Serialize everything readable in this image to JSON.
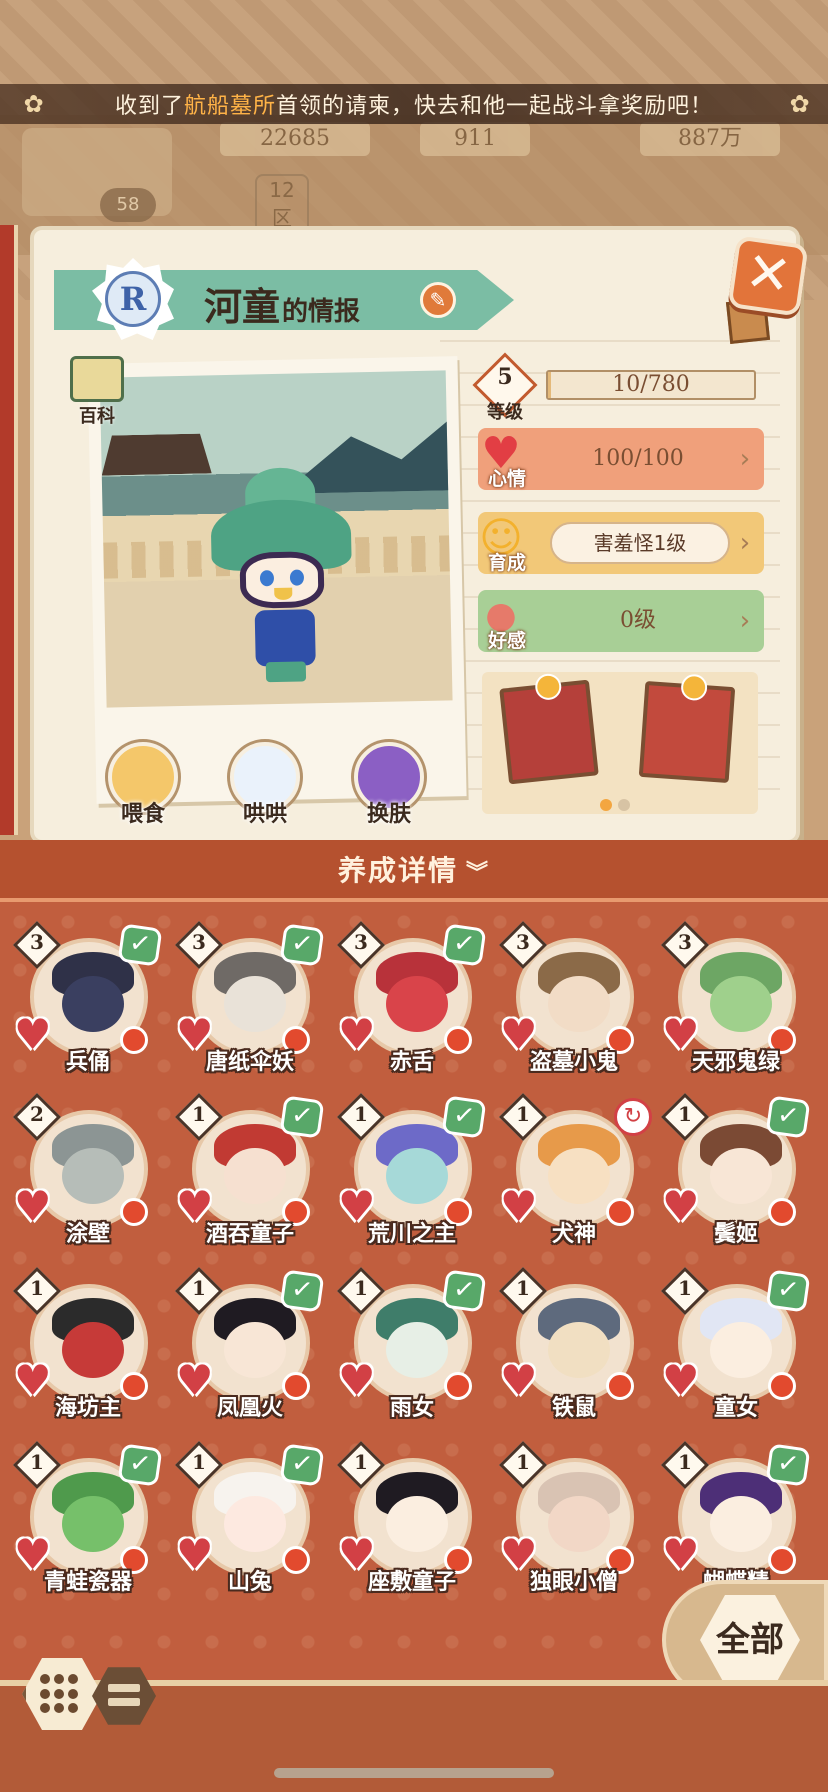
{
  "notice": {
    "prefix": "收到了",
    "highlight": "航船墓所",
    "suffix": "首领的请柬，快去和他一起战斗拿奖励吧！"
  },
  "background": {
    "resource_1": "22685",
    "resource_2": "911",
    "resource_3": "887万",
    "avatar_level": "58",
    "zone_number": "12",
    "zone_suffix": "区"
  },
  "profile": {
    "rarity": "R",
    "name": "河童",
    "title_suffix": "的情报",
    "pedia_label": "百科"
  },
  "actions": [
    {
      "label": "喂食",
      "color": "#f4c76a"
    },
    {
      "label": "哄哄",
      "color": "#eaf2fb"
    },
    {
      "label": "换肤",
      "color": "#8b5fc4"
    }
  ],
  "stats": {
    "level": {
      "value": "5",
      "label": "等级",
      "exp_text": "10/780",
      "exp_fraction": 0.013
    },
    "mood": {
      "label": "心情",
      "value": "100/100"
    },
    "nurture": {
      "label": "育成",
      "value": "害羞怪1级"
    },
    "affinity": {
      "label": "好感",
      "value": "0级"
    }
  },
  "gifts": {
    "page_count": 2,
    "active_page": 1
  },
  "detail": {
    "label": "养成详情",
    "chevron": "︾"
  },
  "shikigami": [
    {
      "name": "兵俑",
      "level": "3",
      "checked": true,
      "hair": "#2f3148",
      "face": "#3a3f60"
    },
    {
      "name": "唐纸伞妖",
      "level": "3",
      "checked": true,
      "hair": "#6f6a66",
      "face": "#e9e2d8"
    },
    {
      "name": "赤舌",
      "level": "3",
      "checked": true,
      "hair": "#b8323a",
      "face": "#d9444a"
    },
    {
      "name": "盗墓小鬼",
      "level": "3",
      "checked": false,
      "hair": "#8b6a48",
      "face": "#f2dcc6"
    },
    {
      "name": "天邪鬼绿",
      "level": "3",
      "checked": false,
      "hair": "#6da664",
      "face": "#9fd08c"
    },
    {
      "name": "涂壁",
      "level": "2",
      "checked": false,
      "hair": "#8c9594",
      "face": "#b6bdb8"
    },
    {
      "name": "酒吞童子",
      "level": "1",
      "checked": true,
      "hair": "#c13a33",
      "face": "#f6e0d0"
    },
    {
      "name": "荒川之主",
      "level": "1",
      "checked": true,
      "hair": "#6d6ac8",
      "face": "#a6d9d8"
    },
    {
      "name": "犬神",
      "level": "1",
      "checked": false,
      "ring": "↻",
      "hair": "#e79a4a",
      "face": "#f7e0c2"
    },
    {
      "name": "鬓姬",
      "level": "1",
      "checked": true,
      "hair": "#7b4a34",
      "face": "#f8e6d6"
    },
    {
      "name": "海坊主",
      "level": "1",
      "checked": false,
      "hair": "#2b2b2b",
      "face": "#c63a38"
    },
    {
      "name": "凤凰火",
      "level": "1",
      "checked": true,
      "hair": "#1f1b22",
      "face": "#f8e6d6"
    },
    {
      "name": "雨女",
      "level": "1",
      "checked": true,
      "hair": "#3f7d6a",
      "face": "#e7efe6"
    },
    {
      "name": "铁鼠",
      "level": "1",
      "checked": false,
      "hair": "#5e6a7d",
      "face": "#f1dfc2"
    },
    {
      "name": "童女",
      "level": "1",
      "checked": true,
      "hair": "#e1e6f4",
      "face": "#fbeee0"
    },
    {
      "name": "青蛙瓷器",
      "level": "1",
      "checked": true,
      "hair": "#4f9a4c",
      "face": "#76c06a"
    },
    {
      "name": "山兔",
      "level": "1",
      "checked": true,
      "hair": "#f7f3ee",
      "face": "#fde9e0"
    },
    {
      "name": "座敷童子",
      "level": "1",
      "checked": false,
      "hair": "#1f1b22",
      "face": "#fbeee0"
    },
    {
      "name": "独眼小僧",
      "level": "1",
      "checked": false,
      "hair": "#d9c3b3",
      "face": "#f2d7c6"
    },
    {
      "name": "蝴蝶精",
      "level": "1",
      "checked": true,
      "hair": "#4d2f77",
      "face": "#fbeee0"
    }
  ],
  "filter": {
    "all_label": "全部"
  },
  "icons": {
    "close": "close-icon",
    "edit": "edit-icon",
    "arrow": "chevron-right-icon",
    "heart": "heart-icon",
    "check": "check-icon"
  }
}
